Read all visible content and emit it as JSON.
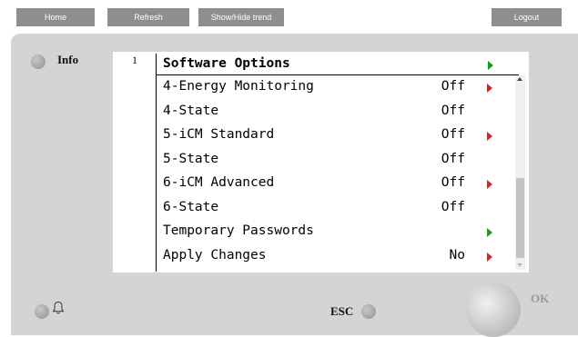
{
  "toolbar": {
    "home_label": "Home",
    "refresh_label": "Refresh",
    "trend_label": "Show/Hide trend",
    "logout_label": "Logout"
  },
  "side": {
    "info_label": "Info"
  },
  "screen": {
    "page_number": "1",
    "title": "Software Options",
    "rows": [
      {
        "label": "4-Energy Monitoring",
        "value": "Off",
        "arrow": "red"
      },
      {
        "label": "4-State",
        "value": "Off",
        "arrow": "none"
      },
      {
        "label": "5-iCM Standard",
        "value": "Off",
        "arrow": "red"
      },
      {
        "label": "5-State",
        "value": "Off",
        "arrow": "none"
      },
      {
        "label": "6-iCM Advanced",
        "value": "Off",
        "arrow": "red"
      },
      {
        "label": "6-State",
        "value": "Off",
        "arrow": "none"
      },
      {
        "label": "Temporary Passwords",
        "value": "",
        "arrow": "green"
      },
      {
        "label": "Apply Changes",
        "value": "No",
        "arrow": "red"
      }
    ]
  },
  "bottom": {
    "esc_label": "ESC",
    "ok_label": "OK"
  },
  "icons": {
    "bell": "bell-icon",
    "arrow_right": "triangle-right-icon"
  },
  "colors": {
    "toolbar_button": "#8e8e8e",
    "panel": "#d4d4d4",
    "arrow_red": "#e02020",
    "arrow_green": "#12a012"
  }
}
